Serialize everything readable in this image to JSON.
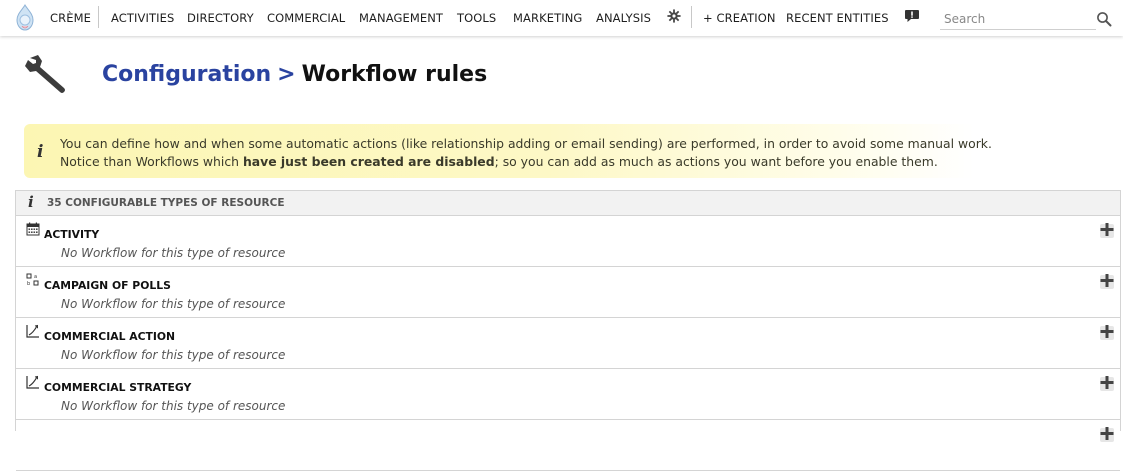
{
  "menu": {
    "home": "CRÈME",
    "items": [
      "ACTIVITIES",
      "DIRECTORY",
      "COMMERCIAL",
      "MANAGEMENT",
      "TOOLS",
      "MARKETING",
      "ANALYSIS"
    ],
    "creation": "+ CREATION",
    "recent": "RECENT ENTITIES"
  },
  "search": {
    "placeholder": "Search",
    "value": ""
  },
  "breadcrumb": {
    "parent": "Configuration",
    "separator": ">",
    "current": "Workflow rules"
  },
  "banner": {
    "line1": "You can define how and when some automatic actions (like relationship adding or email sending) are performed, in order to avoid some manual work.",
    "line2_pre": "Notice than Workflows which ",
    "line2_bold": "have just been created are disabled",
    "line2_post": "; so you can add as much as actions you want before you enable them."
  },
  "panel": {
    "title": "35 Configurable types of resource",
    "resources": [
      {
        "name": "ACTIVITY",
        "icon": "calendar-icon",
        "empty_text": "No Workflow for this type of resource"
      },
      {
        "name": "CAMPAIGN OF POLLS",
        "icon": "poll-icon",
        "empty_text": "No Workflow for this type of resource"
      },
      {
        "name": "COMMERCIAL ACTION",
        "icon": "chart-line-icon",
        "empty_text": "No Workflow for this type of resource"
      },
      {
        "name": "COMMERCIAL STRATEGY",
        "icon": "chart-line-icon",
        "empty_text": "No Workflow for this type of resource"
      }
    ]
  },
  "colors": {
    "link": "#2a43a0",
    "banner": "#fcf6b3",
    "panel_header": "#f2f2f2"
  }
}
